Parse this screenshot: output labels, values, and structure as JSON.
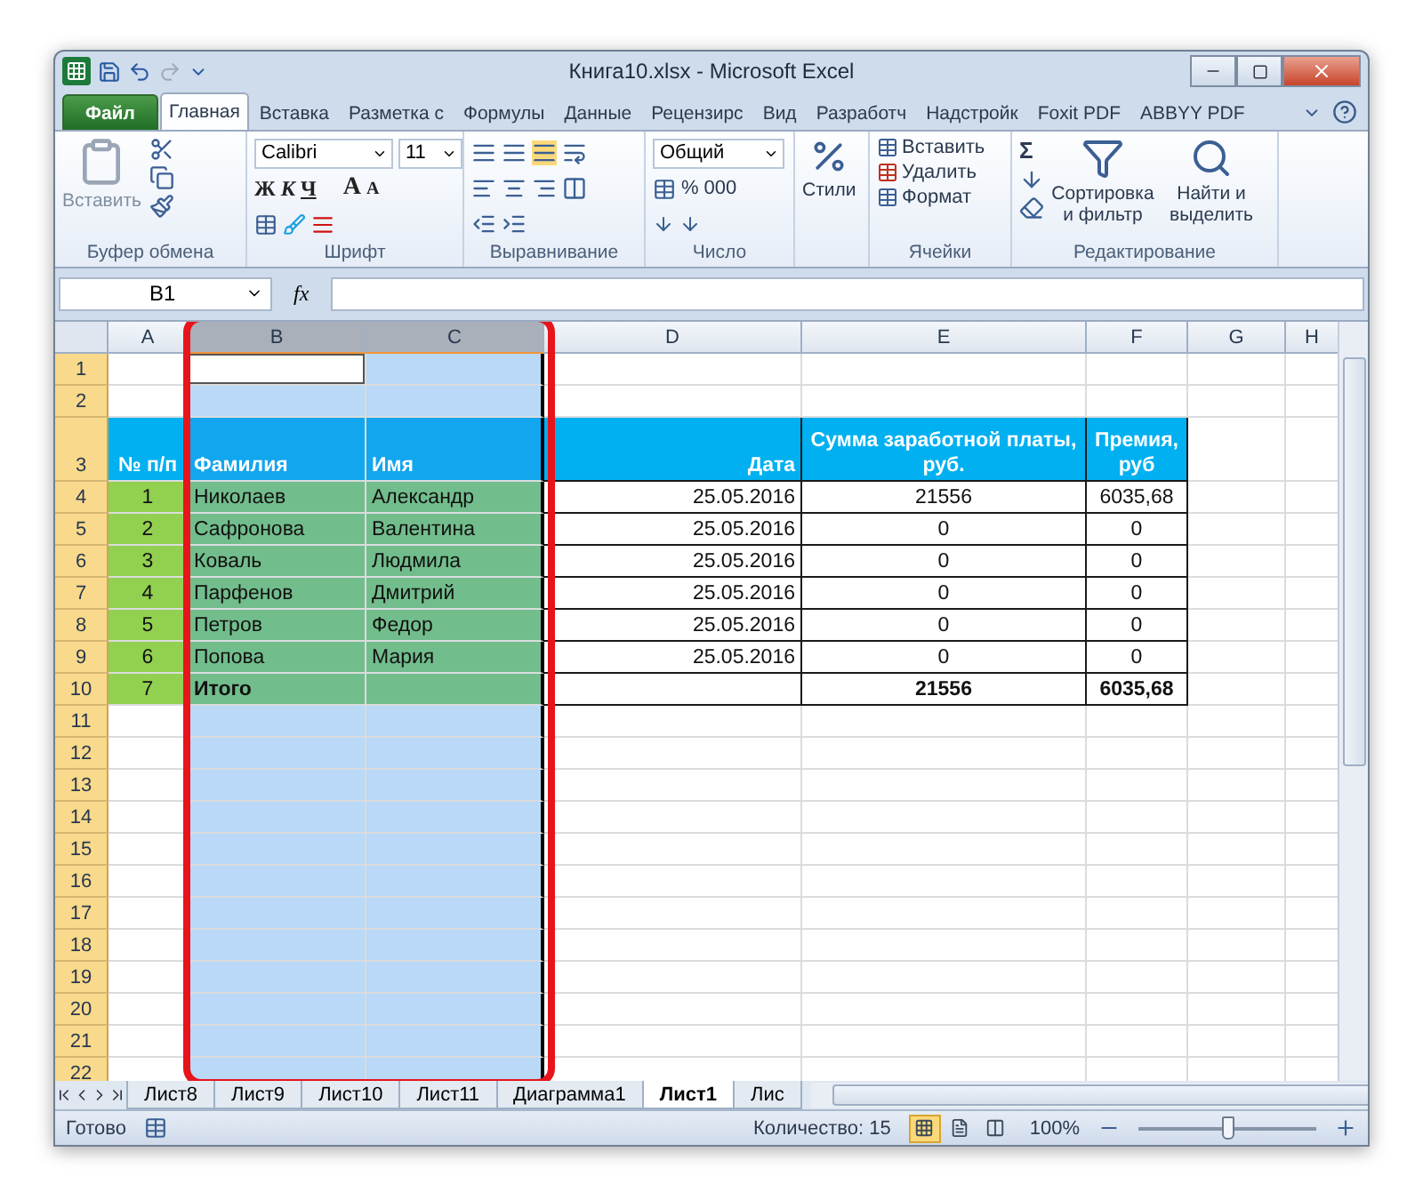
{
  "window": {
    "title": "Книга10.xlsx - Microsoft Excel"
  },
  "ribbon_tabs": [
    {
      "label": "Файл",
      "kind": "file",
      "selected": false
    },
    {
      "label": "Главная",
      "kind": "tab",
      "selected": true
    },
    {
      "label": "Вставка",
      "kind": "tab",
      "selected": false
    },
    {
      "label": "Разметка с",
      "kind": "tab",
      "selected": false
    },
    {
      "label": "Формулы",
      "kind": "tab",
      "selected": false
    },
    {
      "label": "Данные",
      "kind": "tab",
      "selected": false
    },
    {
      "label": "Рецензирс",
      "kind": "tab",
      "selected": false
    },
    {
      "label": "Вид",
      "kind": "tab",
      "selected": false
    },
    {
      "label": "Разработч",
      "kind": "tab",
      "selected": false
    },
    {
      "label": "Надстройк",
      "kind": "tab",
      "selected": false
    },
    {
      "label": "Foxit PDF",
      "kind": "tab",
      "selected": false
    },
    {
      "label": "ABBYY PDF",
      "kind": "tab",
      "selected": false
    }
  ],
  "ribbon": {
    "clipboard": {
      "title": "Буфер обмена",
      "paste": "Вставить"
    },
    "font": {
      "title": "Шрифт",
      "font_name": "Calibri",
      "font_size": "11",
      "bold": "Ж",
      "italic": "К",
      "underline": "Ч",
      "grow": "A",
      "shrink": "A"
    },
    "alignment": {
      "title": "Выравнивание"
    },
    "number": {
      "title": "Число",
      "format": "Общий",
      "percent": "%",
      "thousands": "000"
    },
    "styles": {
      "label": "Стили"
    },
    "cells": {
      "title": "Ячейки",
      "insert": "Вставить",
      "delete": "Удалить",
      "format": "Формат"
    },
    "editing": {
      "title": "Редактирование",
      "sum": "Σ",
      "sort": "Сортировка и фильтр",
      "find": "Найти и выделить"
    }
  },
  "formula_bar": {
    "name_box": "B1",
    "fx": "fx"
  },
  "table": {
    "columns": [
      {
        "label": "A",
        "selected": false,
        "active": false
      },
      {
        "label": "B",
        "selected": true,
        "active": true
      },
      {
        "label": "C",
        "selected": true,
        "active": false
      },
      {
        "label": "D",
        "selected": false,
        "active": false
      },
      {
        "label": "E",
        "selected": false,
        "active": false
      },
      {
        "label": "F",
        "selected": false,
        "active": false
      },
      {
        "label": "G",
        "selected": false,
        "active": false
      },
      {
        "label": "H",
        "selected": false,
        "active": false
      }
    ],
    "rows": [
      {
        "label": "1",
        "kind": "blank",
        "active": true
      },
      {
        "label": "2",
        "kind": "blank",
        "active": false
      },
      {
        "label": "3",
        "kind": "header",
        "active": false,
        "cells": [
          "№ п/п",
          "Фамилия",
          "Имя",
          "Дата",
          "Сумма заработной платы, руб.",
          "Премия, руб"
        ]
      },
      {
        "label": "4",
        "kind": "data",
        "active": false,
        "cells": [
          "1",
          "Николаев",
          "Александр",
          "25.05.2016",
          "21556",
          "6035,68"
        ]
      },
      {
        "label": "5",
        "kind": "data",
        "active": false,
        "cells": [
          "2",
          "Сафронова",
          "Валентина",
          "25.05.2016",
          "0",
          "0"
        ]
      },
      {
        "label": "6",
        "kind": "data",
        "active": false,
        "cells": [
          "3",
          "Коваль",
          "Людмила",
          "25.05.2016",
          "0",
          "0"
        ]
      },
      {
        "label": "7",
        "kind": "data",
        "active": false,
        "cells": [
          "4",
          "Парфенов",
          "Дмитрий",
          "25.05.2016",
          "0",
          "0"
        ]
      },
      {
        "label": "8",
        "kind": "data",
        "active": false,
        "cells": [
          "5",
          "Петров",
          "Федор",
          "25.05.2016",
          "0",
          "0"
        ]
      },
      {
        "label": "9",
        "kind": "data",
        "active": false,
        "cells": [
          "6",
          "Попова",
          "Мария",
          "25.05.2016",
          "0",
          "0"
        ]
      },
      {
        "label": "10",
        "kind": "total",
        "active": false,
        "cells": [
          "7",
          "Итого",
          null,
          null,
          "21556",
          "6035,68"
        ]
      },
      {
        "label": "11",
        "kind": "blank",
        "active": false
      },
      {
        "label": "12",
        "kind": "blank",
        "active": false
      },
      {
        "label": "13",
        "kind": "blank",
        "active": false
      },
      {
        "label": "14",
        "kind": "blank",
        "active": false
      },
      {
        "label": "15",
        "kind": "blank",
        "active": false
      },
      {
        "label": "16",
        "kind": "blank",
        "active": false
      },
      {
        "label": "17",
        "kind": "blank",
        "active": false
      },
      {
        "label": "18",
        "kind": "blank",
        "active": false
      },
      {
        "label": "19",
        "kind": "blank",
        "active": false
      },
      {
        "label": "20",
        "kind": "blank",
        "active": false
      },
      {
        "label": "21",
        "kind": "blank",
        "active": false
      },
      {
        "label": "22",
        "kind": "blank",
        "active": false
      }
    ]
  },
  "sheet_tabs": [
    {
      "label": "Лист8",
      "selected": false
    },
    {
      "label": "Лист9",
      "selected": false
    },
    {
      "label": "Лист10",
      "selected": false
    },
    {
      "label": "Лист11",
      "selected": false
    },
    {
      "label": "Диаграмма1",
      "selected": false
    },
    {
      "label": "Лист1",
      "selected": true
    },
    {
      "label": "Лис",
      "selected": false
    }
  ],
  "status_bar": {
    "status": "Готово",
    "count": "Количество: 15",
    "views": [
      {
        "kind": "normal",
        "selected": true
      },
      {
        "kind": "layout",
        "selected": false
      },
      {
        "kind": "pagebreak",
        "selected": false
      }
    ],
    "zoom": "100%",
    "zoom_slider": {
      "level": 0.5
    }
  }
}
